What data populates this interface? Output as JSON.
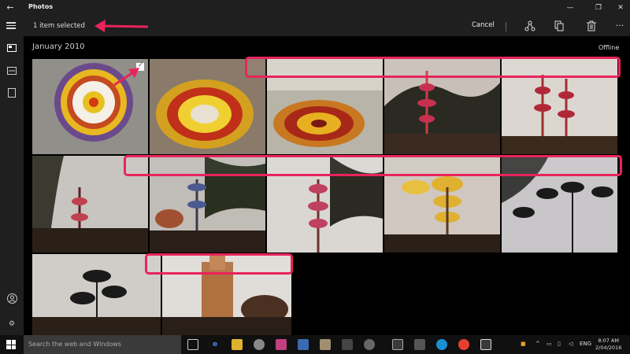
{
  "window": {
    "title": "Photos"
  },
  "commandbar": {
    "selection_text": "1 item selected",
    "cancel_label": "Cancel"
  },
  "gallery": {
    "section_title": "January 2010",
    "status": "Offline"
  },
  "taskbar": {
    "search_placeholder": "Search the web and Windows",
    "language": "ENG",
    "time": "8:07 AM",
    "date": "2/04/2016"
  },
  "colors": {
    "highlight": "#e8245b",
    "chrome": "#1f1f1f"
  }
}
